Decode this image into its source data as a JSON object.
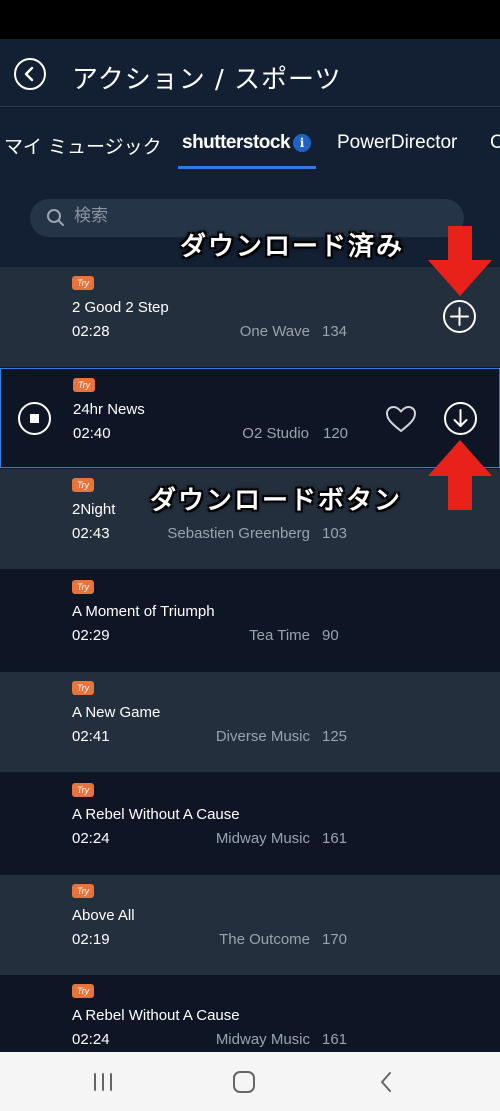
{
  "header": {
    "title": "アクション / スポーツ",
    "back_icon": "back-arrow-circle-icon"
  },
  "tabs": [
    {
      "label": "マイ ミュージック"
    },
    {
      "label": "shutterstock"
    },
    {
      "label": "PowerDirector"
    },
    {
      "label": "C"
    }
  ],
  "search": {
    "placeholder": "検索"
  },
  "annotations": {
    "downloaded": "ダウンロード済み",
    "download_button": "ダウンロードボタン",
    "arrow_color": "#e8221b"
  },
  "try_badge": "Try",
  "tracks": [
    {
      "title": "2 Good 2 Step",
      "duration": "02:28",
      "artist": "One Wave",
      "bpm": "134"
    },
    {
      "title": "24hr News",
      "duration": "02:40",
      "artist": "O2 Studio",
      "bpm": "120"
    },
    {
      "title": "2Night",
      "duration": "02:43",
      "artist": "Sebastien Greenberg",
      "bpm": "103"
    },
    {
      "title": "A Moment of Triumph",
      "duration": "02:29",
      "artist": "Tea Time",
      "bpm": "90"
    },
    {
      "title": "A New Game",
      "duration": "02:41",
      "artist": "Diverse Music",
      "bpm": "125"
    },
    {
      "title": "A Rebel Without A Cause",
      "duration": "02:24",
      "artist": "Midway Music",
      "bpm": "161"
    },
    {
      "title": "Above All",
      "duration": "02:19",
      "artist": "The Outcome",
      "bpm": "170"
    },
    {
      "title": "A Rebel Without A Cause",
      "duration": "02:24",
      "artist": "Midway Music",
      "bpm": "161"
    }
  ],
  "colors": {
    "accent": "#2f7de1",
    "try_badge": "#e8743b",
    "bg_dark": "#0e1626",
    "bg_light": "#242f3d"
  }
}
